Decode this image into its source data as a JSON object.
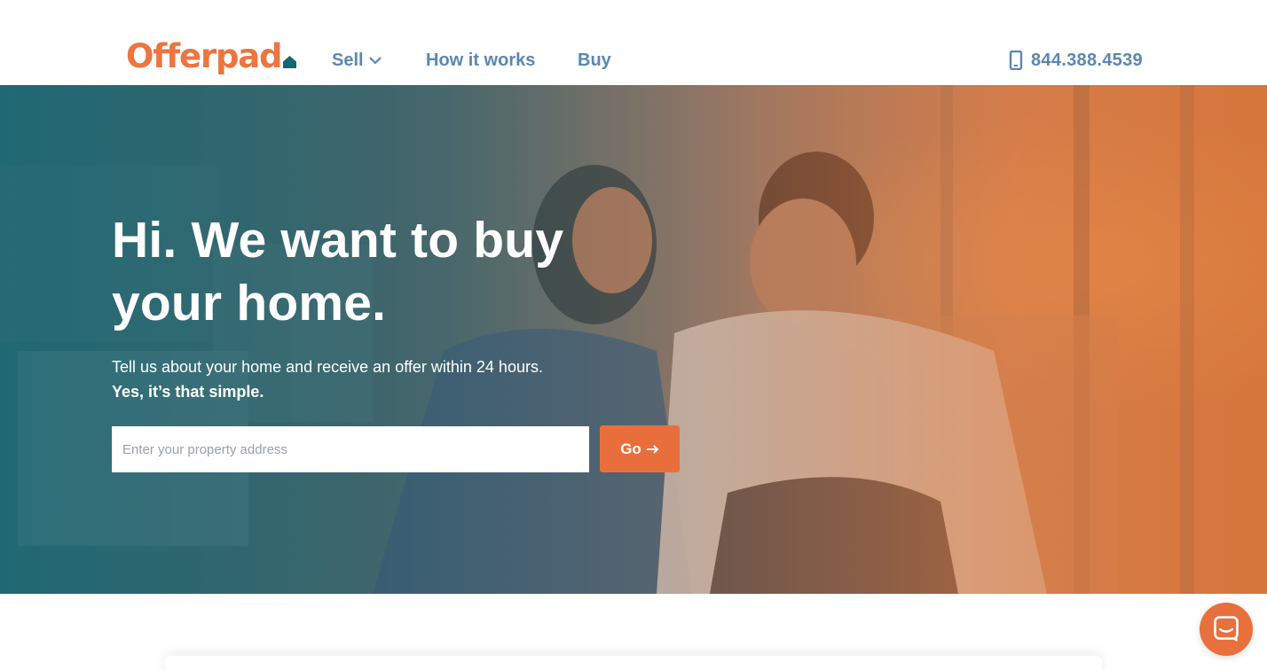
{
  "header": {
    "logo_text": "Offerpad",
    "nav": {
      "sell_label": "Sell",
      "how_label": "How it works",
      "buy_label": "Buy"
    },
    "phone": "844.388.4539"
  },
  "hero": {
    "title": "Hi. We want to buy your home.",
    "subtitle": "Tell us about your home and receive an offer within 24 hours.",
    "subtitle_bold": "Yes, it’s that simple.",
    "search": {
      "placeholder": "Enter your property address",
      "value": ""
    },
    "go_label": "Go"
  },
  "icons": {
    "logo_house": "house-icon",
    "sell_dropdown": "chevron-down-icon",
    "phone": "smartphone-icon",
    "go_arrow": "arrow-right-icon",
    "chat": "chat-icon"
  },
  "colors": {
    "brand_orange": "#ec7540",
    "brand_teal": "#146874",
    "nav_blue": "#5b87b1",
    "button_orange": "#e86f3c"
  }
}
